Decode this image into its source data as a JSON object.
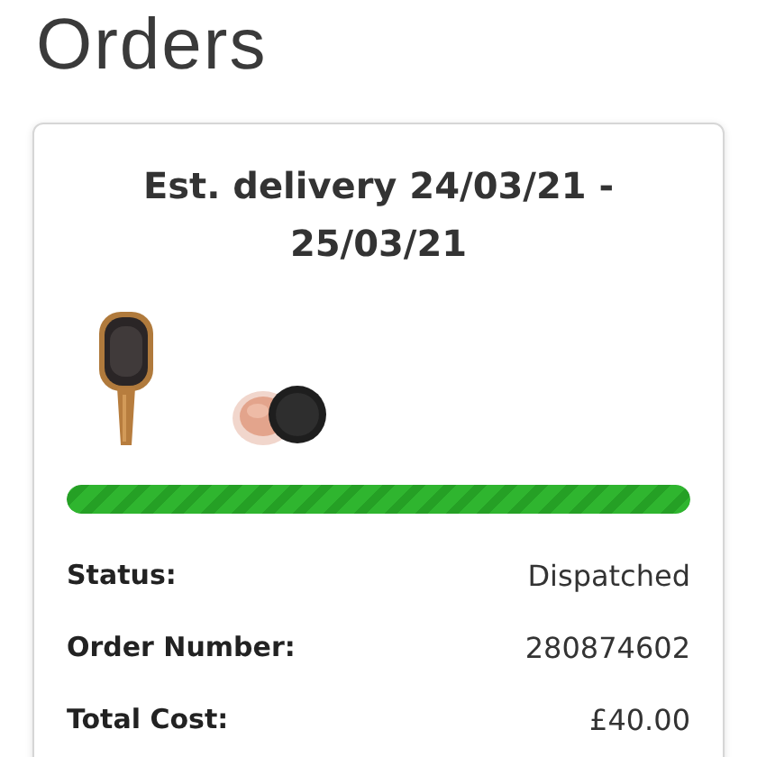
{
  "page": {
    "title": "Orders"
  },
  "order": {
    "heading": "Est. delivery 24/03/21 - 25/03/21",
    "progress": {
      "level": 1
    },
    "details": [
      {
        "label": "Status:",
        "value": "Dispatched"
      },
      {
        "label": "Order Number:",
        "value": "280874602"
      },
      {
        "label": "Total Cost:",
        "value": "£40.00"
      }
    ]
  }
}
